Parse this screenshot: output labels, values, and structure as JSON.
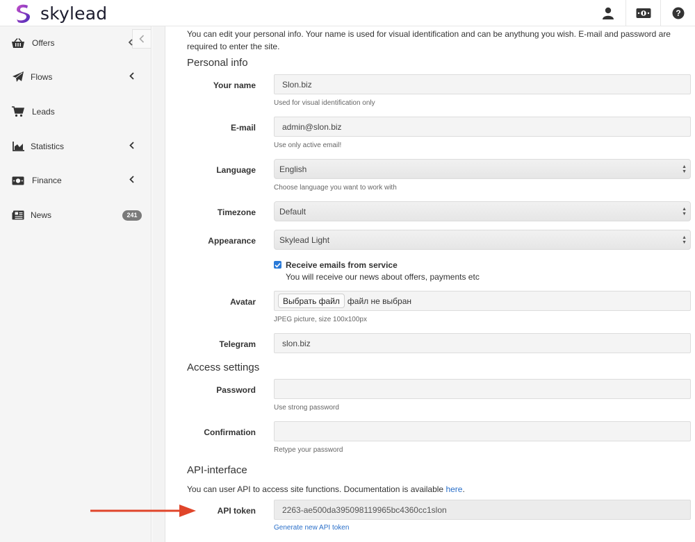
{
  "brand": {
    "name": "skylead",
    "colors": {
      "primary": "#6a32c9",
      "accent": "#c44ec9",
      "link": "#2a6fc9",
      "checkbox": "#2a7ad8",
      "annotation_arrow": "#e0452a"
    }
  },
  "topbar": {
    "icons": [
      "user-icon",
      "money-icon",
      "help-icon"
    ]
  },
  "sidebar": {
    "items": [
      {
        "label": "Offers",
        "icon": "basket-icon",
        "has_chevron": true
      },
      {
        "label": "Flows",
        "icon": "paper-plane-icon",
        "has_chevron": true
      },
      {
        "label": "Leads",
        "icon": "cart-icon",
        "has_chevron": false
      },
      {
        "label": "Statistics",
        "icon": "area-chart-icon",
        "has_chevron": true
      },
      {
        "label": "Finance",
        "icon": "money-icon",
        "has_chevron": true
      },
      {
        "label": "News",
        "icon": "newspaper-icon",
        "has_chevron": false,
        "badge": "241"
      }
    ]
  },
  "profile": {
    "intro": "You can edit your personal info. Your name is used for visual identification and can be anythung you wish. E-mail and password are required to enter the site.",
    "personal_title": "Personal info",
    "name": {
      "label": "Your name",
      "value": "Slon.biz",
      "help": "Used for visual identification only"
    },
    "email": {
      "label": "E-mail",
      "value": "admin@slon.biz",
      "help": "Use only active email!"
    },
    "language": {
      "label": "Language",
      "value": "English",
      "help": "Choose language you want to work with"
    },
    "timezone": {
      "label": "Timezone",
      "value": "Default"
    },
    "appearance": {
      "label": "Appearance",
      "value": "Skylead Light"
    },
    "emails_opt": {
      "label": "Receive emails from service",
      "sub": "You will receive our news about offers, payments etc",
      "checked": true
    },
    "avatar": {
      "label": "Avatar",
      "button": "Выбрать файл",
      "status": "файл не выбран",
      "help": "JPEG picture, size 100x100px"
    },
    "telegram": {
      "label": "Telegram",
      "value": "slon.biz"
    }
  },
  "access": {
    "title": "Access settings",
    "password": {
      "label": "Password",
      "value": "",
      "help": "Use strong password"
    },
    "confirmation": {
      "label": "Confirmation",
      "value": "",
      "help": "Retype your password"
    }
  },
  "api": {
    "title": "API-interface",
    "desc_prefix": "You can user API to access site functions. Documentation is available ",
    "desc_link": "here",
    "desc_suffix": ".",
    "token": {
      "label": "API token",
      "value": "2263-ae500da395098119965bc4360cc1slon"
    },
    "generate": "Generate new API token"
  }
}
